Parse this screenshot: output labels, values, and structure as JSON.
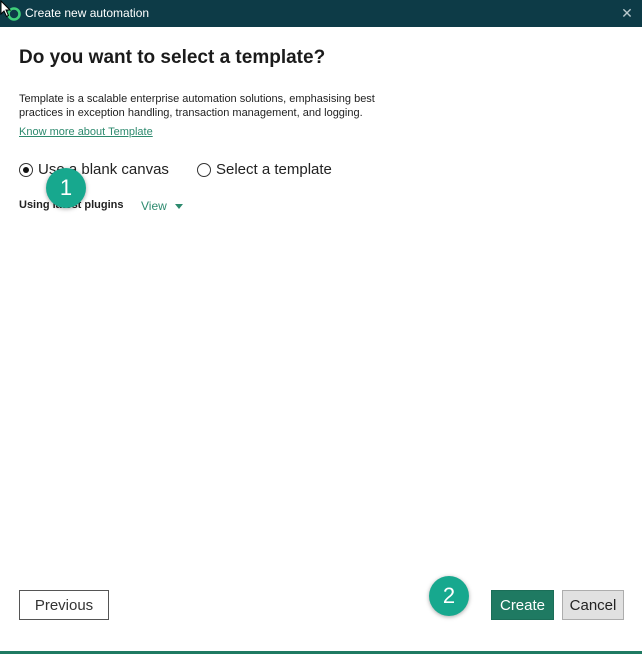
{
  "window": {
    "title": "Create new automation",
    "close_glyph": "✕",
    "icon": "app-logo-icon"
  },
  "dialog": {
    "heading": "Do you want to select a template?",
    "description": "Template is a scalable enterprise automation solutions, emphasising best practices in exception handling, transaction management, and logging.",
    "know_more_link": "Know more about Template",
    "options": [
      {
        "label": "Use a blank canvas",
        "selected": true
      },
      {
        "label": "Select a template",
        "selected": false
      }
    ],
    "plugins_label": "Using latest plugins",
    "view_link": "View"
  },
  "steps": {
    "step1": "1",
    "step2": "2"
  },
  "buttons": {
    "previous": "Previous",
    "create": "Create",
    "cancel": "Cancel"
  },
  "colors": {
    "titlebar": "#0d3b47",
    "accent": "#1f7a62",
    "badge": "#17a88e",
    "link": "#2d8a6e"
  }
}
